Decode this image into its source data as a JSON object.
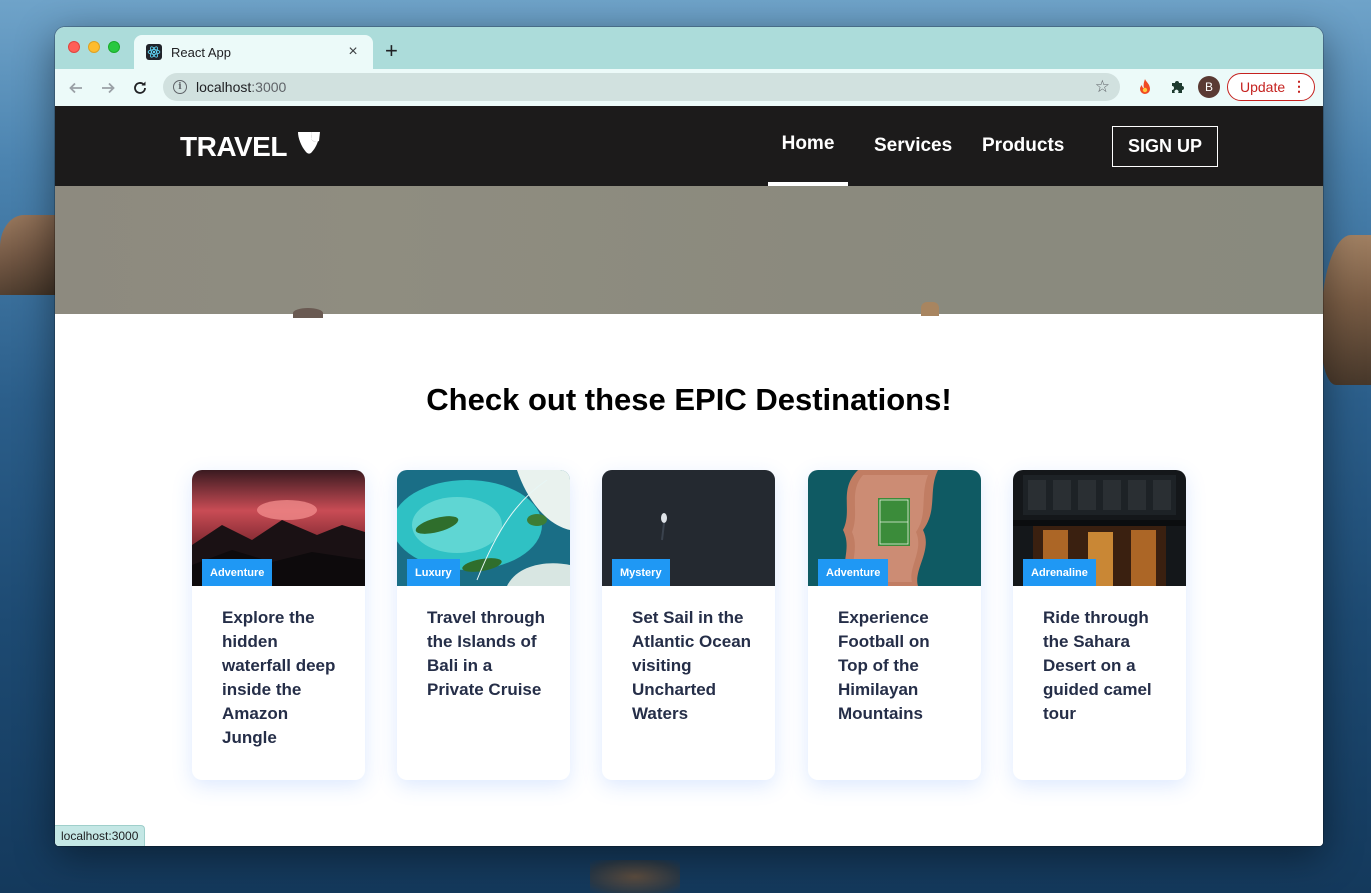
{
  "browser": {
    "tab_title": "React App",
    "tab_favicon": "react-icon",
    "close_glyph": "×",
    "new_tab_glyph": "+",
    "url_host": "localhost",
    "url_port": ":3000",
    "info_glyph": "i",
    "star_glyph": "☆",
    "profile_initial": "B",
    "update_label": "Update",
    "update_menu_glyph": "⋮",
    "status_url": "localhost:3000",
    "tabstrip_color": "#acdcda",
    "toolbar_color": "#ecfaf9",
    "update_color": "#c5221f"
  },
  "site": {
    "logo_text": "TRAVEL",
    "logo_icon": "typo3-icon",
    "nav": {
      "home": "Home",
      "services": "Services",
      "products": "Products"
    },
    "signup_label": "SIGN UP",
    "navbar_color": "#1c1b1b",
    "section_title": "Check out these EPIC Destinations!",
    "badge_color": "#1f98f4",
    "card_text_color": "#252e48",
    "cards": [
      {
        "label": "Adventure",
        "text": "Explore the hidden waterfall deep inside the Amazon Jungle",
        "image": "mountain-sunset-image"
      },
      {
        "label": "Luxury",
        "text": "Travel through the Islands of Bali in a Private Cruise",
        "image": "tropical-islands-image"
      },
      {
        "label": "Mystery",
        "text": "Set Sail in the Atlantic Ocean visiting Uncharted Waters",
        "image": "dark-ocean-image"
      },
      {
        "label": "Adventure",
        "text": "Experience Football on Top of the Himilayan Mountains",
        "image": "island-football-field-image"
      },
      {
        "label": "Adrenaline",
        "text": "Ride through the Sahara Desert on a guided camel tour",
        "image": "building-entrance-night-image"
      }
    ]
  }
}
